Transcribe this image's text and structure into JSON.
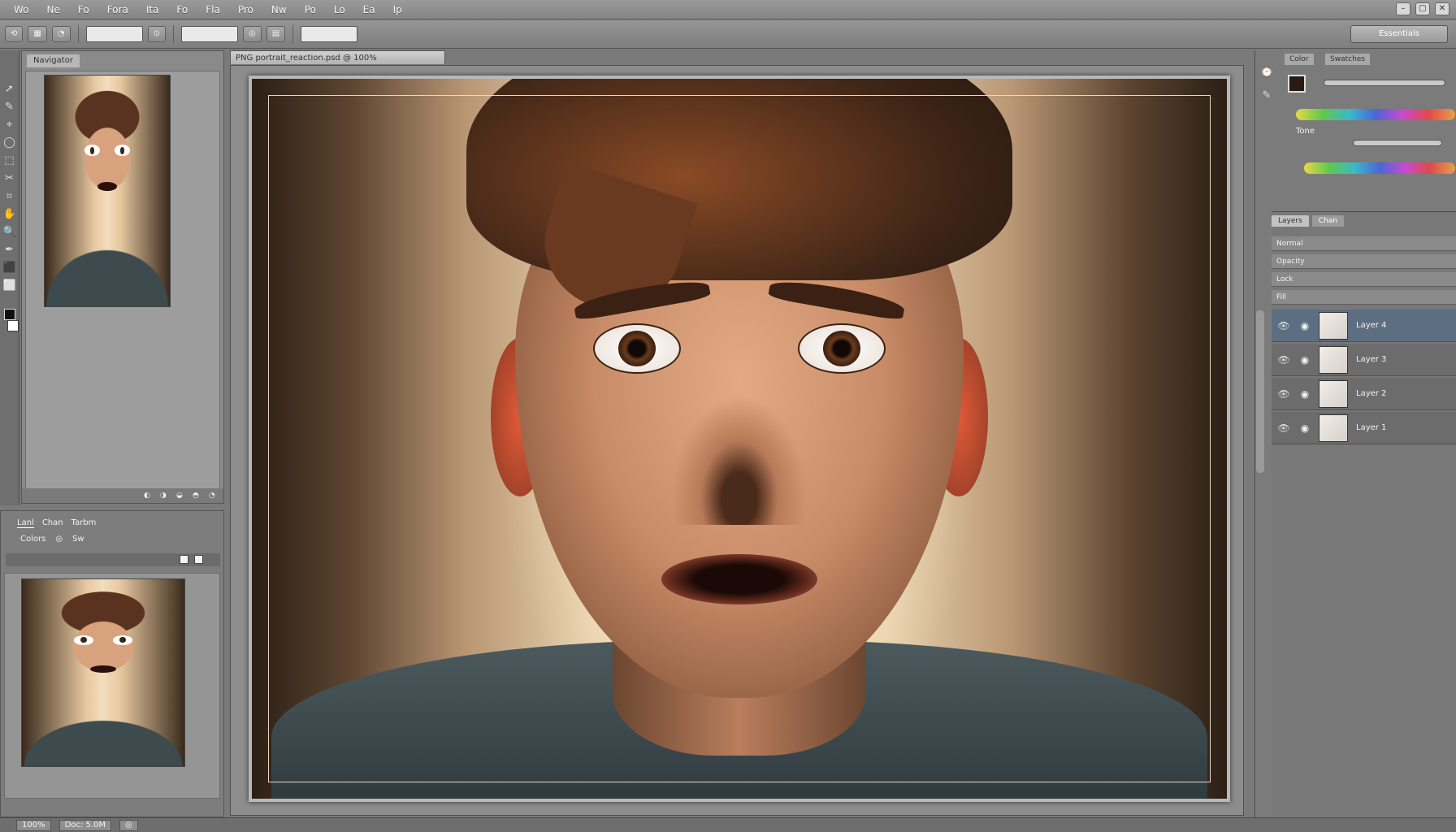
{
  "menu": {
    "items": [
      "Wo",
      "Ne",
      "Fo",
      "Fora",
      "Ita",
      "Fo",
      "Fla",
      "Pro",
      "Nw",
      "Po",
      "Lo",
      "Ea",
      "Ip"
    ]
  },
  "window": {
    "minimize": "–",
    "maximize": "▢",
    "close": "✕"
  },
  "options": {
    "btn1": "⟲",
    "btn2": "▦",
    "btn3": "◔",
    "input1_value": "",
    "btn4": "⊙",
    "input2_value": "",
    "btn5": "◎",
    "btn6": "▤",
    "input3_value": "",
    "workspace_label": "Essentials"
  },
  "tools": [
    "➚",
    "✎",
    "⌖",
    "◯",
    "⬚",
    "✂",
    "⌗",
    "✋",
    "🔍",
    "✒",
    "⬛",
    "⬜"
  ],
  "left_panel": {
    "tab": "Navigator",
    "footer_icons": [
      "◐",
      "◑",
      "◒",
      "◓",
      "◔"
    ]
  },
  "left_panel_2": {
    "tabs": [
      "Lanl",
      "Chan",
      "Tarbm"
    ],
    "row2": [
      "Colors",
      "◎",
      "Sw"
    ]
  },
  "document": {
    "tab_title": "PNG portrait_reaction.psd @ 100%"
  },
  "right_dock": {
    "tab1": "Color",
    "tab2": "Swatches",
    "label1": "Tone",
    "layers_tabs": [
      "Layers",
      "Chan"
    ],
    "layer_opt_rows": [
      "Normal",
      "Opacity",
      "Lock",
      "Fill"
    ],
    "layers": [
      {
        "name": "Layer 4"
      },
      {
        "name": "Layer 3"
      },
      {
        "name": "Layer 2"
      },
      {
        "name": "Layer 1"
      }
    ]
  },
  "status": {
    "zoom": "100%",
    "doc": "Doc: 5.0M",
    "info": "◎"
  },
  "colors": {
    "accent": "#5e6e82",
    "chrome": "#7b7b7b"
  }
}
